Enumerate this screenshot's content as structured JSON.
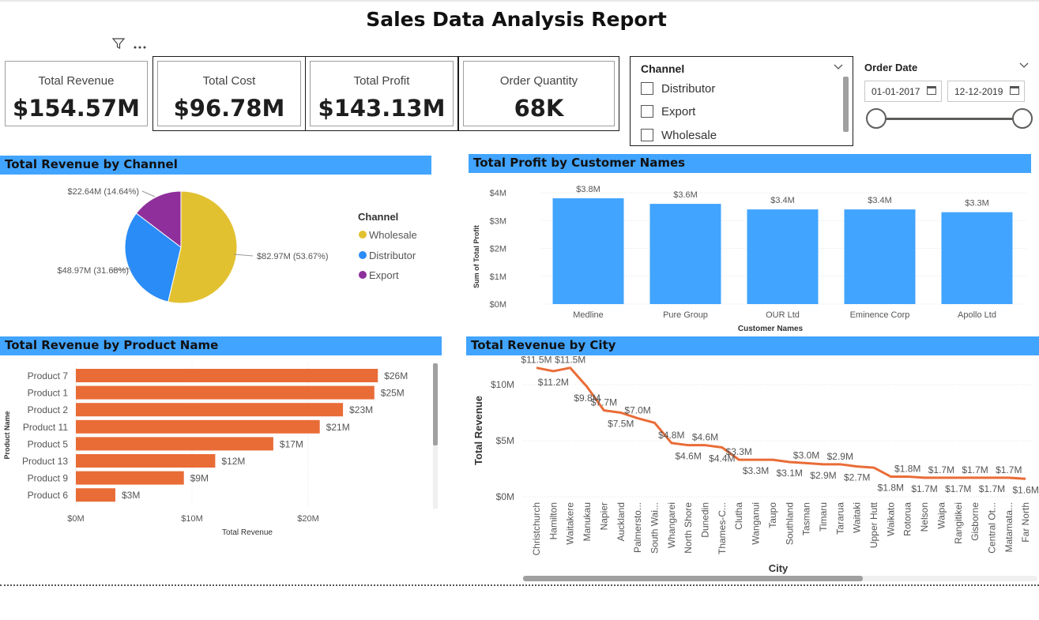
{
  "title": "Sales Data Analysis Report",
  "kpis": [
    {
      "label": "Total Revenue",
      "value": "$154.57M"
    },
    {
      "label": "Total Cost",
      "value": "$96.78M"
    },
    {
      "label": "Total Profit",
      "value": "$143.13M"
    },
    {
      "label": "Order Quantity",
      "value": "68K"
    }
  ],
  "channel_slicer": {
    "title": "Channel",
    "options": [
      "Distributor",
      "Export",
      "Wholesale"
    ]
  },
  "date_slicer": {
    "title": "Order Date",
    "start": "01-01-2017",
    "end": "12-12-2019"
  },
  "colors": {
    "header": "#41a4ff",
    "wholesale": "#e2c131",
    "distributor": "#2a8cf6",
    "export": "#8e2f9b",
    "profit_bar": "#41a4ff",
    "product_bar": "#e96c37",
    "city_line": "#e96c37"
  },
  "icons": [
    "filter-icon",
    "more-options-icon",
    "chevron-down-icon",
    "calendar-icon"
  ],
  "headers": {
    "channel": "Total Revenue by Channel",
    "profit": "Total Profit by Customer Names",
    "product": "Total Revenue by Product Name",
    "city": "Total Revenue by City"
  },
  "chart_data": [
    {
      "type": "pie",
      "title": "Total Revenue by Channel",
      "legend_title": "Channel",
      "legend_position": "right",
      "slices": [
        {
          "name": "Wholesale",
          "value": 82.97,
          "label": "$82.97M (53.67%)",
          "color": "#e2c131"
        },
        {
          "name": "Distributor",
          "value": 48.97,
          "label": "$48.97M (31.68%)",
          "color": "#2a8cf6"
        },
        {
          "name": "Export",
          "value": 22.64,
          "label": "$22.64M (14.64%)",
          "color": "#8e2f9b"
        }
      ]
    },
    {
      "type": "bar",
      "title": "Total Profit by Customer Names",
      "categories": [
        "Medline",
        "Pure Group",
        "OUR Ltd",
        "Eminence Corp",
        "Apollo Ltd"
      ],
      "values": [
        3.8,
        3.6,
        3.4,
        3.4,
        3.3
      ],
      "data_labels": [
        "$3.8M",
        "$3.6M",
        "$3.4M",
        "$3.4M",
        "$3.3M"
      ],
      "xlabel": "Customer Names",
      "ylabel": "Sum of Total Profit",
      "yticks": [
        "$0M",
        "$1M",
        "$2M",
        "$3M",
        "$4M"
      ],
      "ylim": [
        0,
        4
      ],
      "grid": true
    },
    {
      "type": "bar",
      "orientation": "horizontal",
      "title": "Total Revenue by Product Name",
      "categories": [
        "Product 7",
        "Product 1",
        "Product 2",
        "Product 11",
        "Product 5",
        "Product 13",
        "Product 9",
        "Product 6"
      ],
      "values": [
        26,
        25.7,
        23,
        21,
        17,
        12,
        9.3,
        3.4
      ],
      "data_labels": [
        "$26M",
        "$25M",
        "$23M",
        "$21M",
        "$17M",
        "$12M",
        "$9M",
        "$3M"
      ],
      "xlabel": "Total Revenue",
      "ylabel": "Product Name",
      "xticks": [
        "$0M",
        "$10M",
        "$20M"
      ],
      "xlim": [
        0,
        29
      ],
      "grid": true
    },
    {
      "type": "line",
      "title": "Total Revenue by City",
      "categories": [
        "Christchurch",
        "Hamilton",
        "Waitakere",
        "Manukau",
        "Napier",
        "Auckland",
        "Palmersto...",
        "South Wai...",
        "Whangarei",
        "North Shore",
        "Dunedin",
        "Thames-C...",
        "Clutha",
        "Wanganui",
        "Taupo",
        "Southland",
        "Tasman",
        "Timaru",
        "Tararua",
        "Waitaki",
        "Upper Hutt",
        "Waikato",
        "Rotorua",
        "Nelson",
        "Waipa",
        "Rangitikei",
        "Gisborne",
        "Central Ot...",
        "Matamata...",
        "Far North"
      ],
      "values": [
        11.5,
        11.2,
        11.5,
        9.8,
        7.7,
        7.5,
        7.0,
        6.6,
        4.8,
        4.6,
        4.6,
        4.4,
        3.3,
        3.3,
        3.3,
        3.1,
        3.0,
        2.9,
        2.9,
        2.7,
        2.6,
        1.8,
        1.8,
        1.7,
        1.7,
        1.7,
        1.7,
        1.7,
        1.7,
        1.6
      ],
      "data_labels": [
        "$11.5M",
        "$11.2M",
        "$11.5M",
        "$9.8M",
        "$7.7M",
        "$7.5M",
        "$7.0M",
        "",
        "$4.8M",
        "$4.6M",
        "$4.6M",
        "$4.4M",
        "$3.3M",
        "$3.3M",
        "",
        "$3.1M",
        "$3.0M",
        "$2.9M",
        "$2.9M",
        "$2.7M",
        "",
        "$1.8M",
        "$1.8M",
        "$1.7M",
        "$1.7M",
        "$1.7M",
        "$1.7M",
        "$1.7M",
        "$1.7M",
        "$1.6M"
      ],
      "xlabel": "City",
      "ylabel": "Total Revenue",
      "yticks": [
        "$0M",
        "$5M",
        "$10M"
      ],
      "ylim": [
        0,
        12.5
      ],
      "grid": true
    }
  ]
}
